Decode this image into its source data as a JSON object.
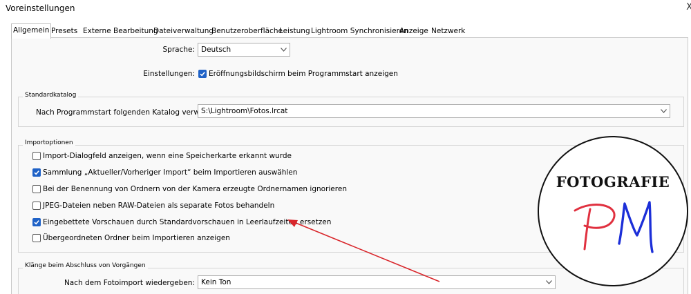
{
  "window": {
    "title": "Voreinstellungen",
    "close_glyph": "X"
  },
  "tabs": [
    {
      "label": "Allgemein",
      "active": true
    },
    {
      "label": "Presets",
      "active": false
    },
    {
      "label": "Externe Bearbeitung",
      "active": false
    },
    {
      "label": "Dateiverwaltung",
      "active": false
    },
    {
      "label": "Benutzeroberfläche",
      "active": false
    },
    {
      "label": "Leistung",
      "active": false
    },
    {
      "label": "Lightroom Synchronisieren",
      "active": false
    },
    {
      "label": "Anzeige",
      "active": false
    },
    {
      "label": "Netzwerk",
      "active": false
    }
  ],
  "general": {
    "language_label": "Sprache:",
    "language_value": "Deutsch",
    "settings_label": "Einstellungen:",
    "splash_label": "Eröffnungsbildschirm beim Programmstart anzeigen",
    "splash_checked": true
  },
  "catalog": {
    "group_title": "Standardkatalog",
    "startup_label": "Nach Programmstart folgenden Katalog verwenden:",
    "startup_value": "S:\\Lightroom\\Fotos.lrcat"
  },
  "import": {
    "group_title": "Importoptionen",
    "options": [
      {
        "label": "Import-Dialogfeld anzeigen, wenn eine Speicherkarte erkannt wurde",
        "checked": false
      },
      {
        "label": "Sammlung „Aktueller/Vorheriger Import“ beim Importieren auswählen",
        "checked": true
      },
      {
        "label": "Bei der Benennung von Ordnern von der Kamera erzeugte Ordnernamen ignorieren",
        "checked": false
      },
      {
        "label": "JPEG-Dateien neben RAW-Dateien als separate Fotos behandeln",
        "checked": false
      },
      {
        "label": "Eingebettete Vorschauen durch Standardvorschauen in Leerlaufzeiten ersetzen",
        "checked": true
      },
      {
        "label": "Übergeordneten Ordner beim Importieren anzeigen",
        "checked": false
      }
    ]
  },
  "sounds": {
    "group_title": "Klänge beim Abschluss von Vorgängen",
    "photo_import_label": "Nach dem Fotoimport wiedergeben:",
    "photo_import_value": "Kein Ton"
  },
  "watermark": {
    "text": "FOTOGRAFIE",
    "monogram": "PM",
    "ink_p": "#e0303f",
    "ink_m": "#1c2fd8"
  },
  "colors": {
    "accent": "#1f62c7",
    "annotation_arrow": "#d9262b"
  },
  "icons": {
    "dropdown": "chevron-down-icon",
    "checkmark": "checkmark-icon"
  }
}
